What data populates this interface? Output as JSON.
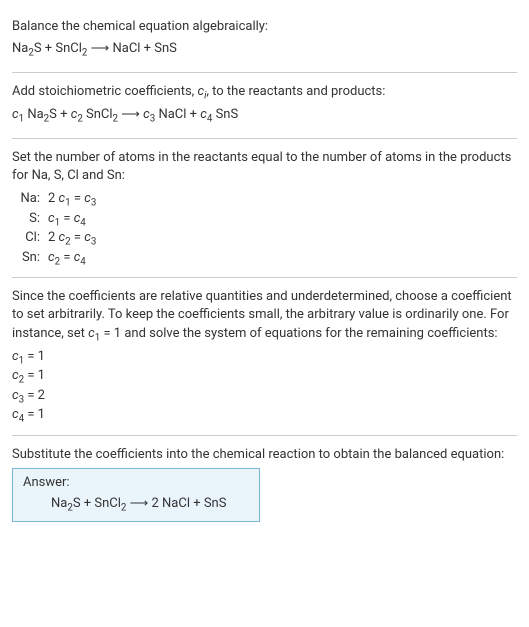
{
  "section1": {
    "title": "Balance the chemical equation algebraically:",
    "eqn_parts": {
      "na2s": "Na",
      "s": "S + SnCl",
      "arrow": " ⟶ NaCl + SnS"
    }
  },
  "section2": {
    "title_a": "Add stoichiometric coefficients, ",
    "title_b": ", to the reactants and products:",
    "ci": "c",
    "ci_sub": "i"
  },
  "section3": {
    "title": "Set the number of atoms in the reactants equal to the number of atoms in the products for Na, S, Cl and Sn:",
    "rows": {
      "na_label": "Na:",
      "na_eq_a": "2 ",
      "na_eq_b": " = ",
      "s_label": "S:",
      "s_eq_b": " = ",
      "cl_label": "Cl:",
      "cl_eq_a": "2 ",
      "cl_eq_b": " = ",
      "sn_label": "Sn:",
      "sn_eq_b": " = "
    }
  },
  "section4": {
    "title_a": "Since the coefficients are relative quantities and underdetermined, choose a coefficient to set arbitrarily. To keep the coefficients small, the arbitrary value is ordinarily one. For instance, set ",
    "title_b": " = 1 and solve the system of equations for the remaining coefficients:",
    "c1": " = 1",
    "c2": " = 1",
    "c3": " = 2",
    "c4": " = 1"
  },
  "section5": {
    "title": "Substitute the coefficients into the chemical reaction to obtain the balanced equation:",
    "answer_label": "Answer:",
    "answer_a": "Na",
    "answer_b": "S + SnCl",
    "answer_c": " ⟶ 2 NaCl + SnS"
  },
  "sym": {
    "c": "c",
    "sub1": "1",
    "sub2": "2",
    "sub3": "3",
    "sub4": "4",
    "two": "2",
    "na2s_a": " Na",
    "na2s_b": "S + ",
    "sncl2_a": " SnCl",
    "arrow": " ⟶ ",
    "part3": " NaCl + ",
    "part4": " SnS"
  }
}
